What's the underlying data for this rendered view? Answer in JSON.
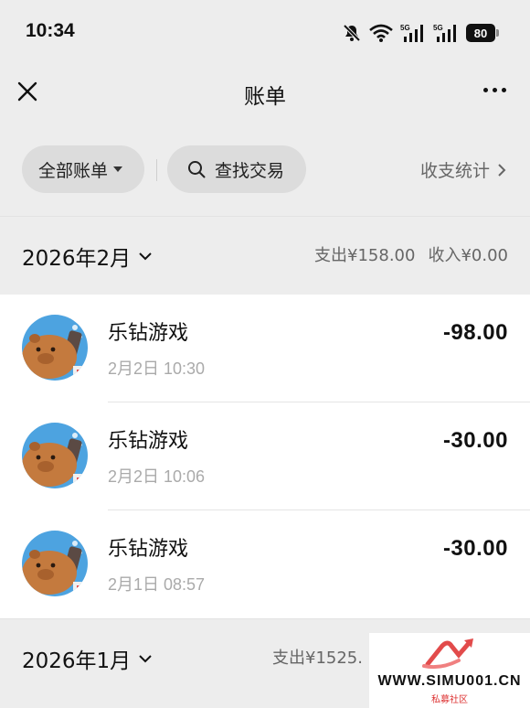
{
  "status_bar": {
    "time": "10:34",
    "battery": "80"
  },
  "nav": {
    "title": "账单"
  },
  "filters": {
    "all_bills": "全部账单",
    "search": "查找交易",
    "stats": "收支统计"
  },
  "months": [
    {
      "label": "2026年2月",
      "expense": "支出¥158.00",
      "income": "收入¥0.00"
    },
    {
      "label": "2026年1月",
      "expense": "支出¥1525.",
      "income": ""
    }
  ],
  "transactions": [
    {
      "name": "乐钻游戏",
      "time": "2月2日 10:30",
      "amount": "-98.00"
    },
    {
      "name": "乐钻游戏",
      "time": "2月2日 10:06",
      "amount": "-30.00"
    },
    {
      "name": "乐钻游戏",
      "time": "2月1日 08:57",
      "amount": "-30.00"
    }
  ],
  "watermark": {
    "url": "WWW.SIMU001.CN",
    "sub": "私募社区"
  },
  "colors": {
    "background": "#ededed",
    "list_bg": "#ffffff",
    "avatar_blue": "#4da3e0",
    "avatar_brown": "#c47a3e"
  }
}
